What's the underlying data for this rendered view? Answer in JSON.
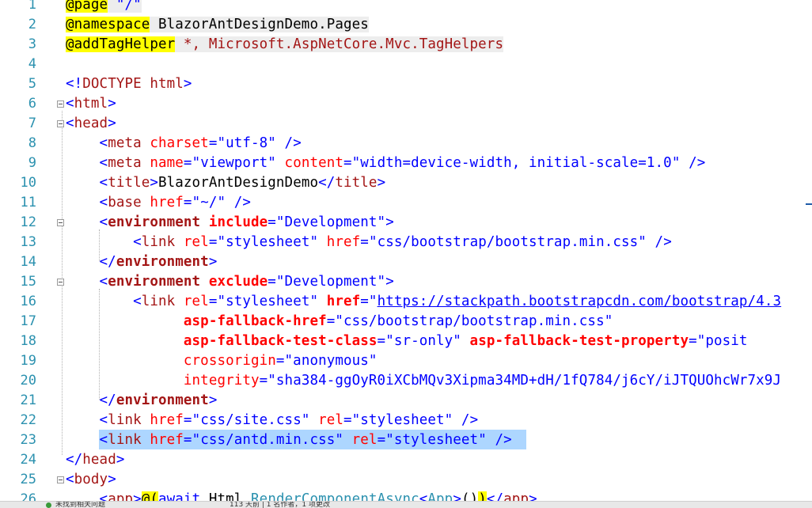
{
  "editor": {
    "line_numbers": [
      "1",
      "2",
      "3",
      "4",
      "5",
      "6",
      "7",
      "8",
      "9",
      "10",
      "11",
      "12",
      "13",
      "14",
      "15",
      "16",
      "17",
      "18",
      "19",
      "20",
      "21",
      "22",
      "23",
      "24",
      "25",
      "26"
    ],
    "lines": {
      "l1": {
        "dir": "@page",
        "rest": " \"/\""
      },
      "l2": {
        "dir": "@namespace",
        "rest": " BlazorAntDesignDemo.Pages"
      },
      "l3": {
        "dir": "@addTagHelper",
        "rest": " *, Microsoft.AspNetCore.Mvc.TagHelpers"
      },
      "l5": {
        "open": "<!",
        "tag": "DOCTYPE",
        "attr": " html",
        "close": ">"
      },
      "l6": {
        "open": "<",
        "tag": "html",
        "close": ">"
      },
      "l7": {
        "open": "<",
        "tag": "head",
        "close": ">"
      },
      "l8": {
        "indent": "    ",
        "open": "<",
        "tag": "meta",
        "a1": " charset",
        "eq1": "=",
        "v1": "\"utf-8\"",
        "close": " />"
      },
      "l9": {
        "indent": "    ",
        "open": "<",
        "tag": "meta",
        "a1": " name",
        "eq1": "=",
        "v1": "\"viewport\"",
        "a2": " content",
        "eq2": "=",
        "v2": "\"width=device-width, initial-scale=1.0\"",
        "close": " />"
      },
      "l10": {
        "indent": "    ",
        "open": "<",
        "tag": "title",
        "close": ">",
        "text": "BlazorAntDesignDemo",
        "end_open": "</",
        "end_tag": "title",
        "end_close": ">"
      },
      "l11": {
        "indent": "    ",
        "open": "<",
        "tag": "base",
        "a1": " href",
        "eq1": "=",
        "v1": "\"~/\"",
        "close": " />"
      },
      "l12": {
        "indent": "    ",
        "open": "<",
        "tag": "environment",
        "a1": " include",
        "eq1": "=",
        "v1": "\"Development\"",
        "close": ">"
      },
      "l13": {
        "indent": "        ",
        "open": "<",
        "tag": "link",
        "a1": " rel",
        "eq1": "=",
        "v1": "\"stylesheet\"",
        "a2": " href",
        "eq2": "=",
        "v2": "\"css/bootstrap/bootstrap.min.css\"",
        "close": " />"
      },
      "l14": {
        "indent": "    ",
        "open": "</",
        "tag": "environment",
        "close": ">"
      },
      "l15": {
        "indent": "    ",
        "open": "<",
        "tag": "environment",
        "a1": " exclude",
        "eq1": "=",
        "v1": "\"Development\"",
        "close": ">"
      },
      "l16": {
        "indent": "        ",
        "open": "<",
        "tag": "link",
        "a1": " rel",
        "eq1": "=",
        "v1": "\"stylesheet\"",
        "a2": " href",
        "eq2": "=\"",
        "v2": "https://stackpath.bootstrapcdn.com/bootstrap/4.3"
      },
      "l17": {
        "indent": "              ",
        "a1": "asp-fallback-href",
        "eq1": "=",
        "v1": "\"css/bootstrap/bootstrap.min.css\""
      },
      "l18": {
        "indent": "              ",
        "a1": "asp-fallback-test-class",
        "eq1": "=",
        "v1": "\"sr-only\"",
        "a2": " asp-fallback-test-property",
        "eq2": "=",
        "v2": "\"posit"
      },
      "l19": {
        "indent": "              ",
        "a1": "crossorigin",
        "eq1": "=",
        "v1": "\"anonymous\""
      },
      "l20": {
        "indent": "              ",
        "a1": "integrity",
        "eq1": "=",
        "v1": "\"sha384-ggOyR0iXCbMQv3Xipma34MD+dH/1fQ784/j6cY/iJTQUOhcWr7x9J"
      },
      "l21": {
        "indent": "    ",
        "open": "</",
        "tag": "environment",
        "close": ">"
      },
      "l22": {
        "indent": "    ",
        "open": "<",
        "tag": "link",
        "a1": " href",
        "eq1": "=",
        "v1": "\"css/site.css\"",
        "a2": " rel",
        "eq2": "=",
        "v2": "\"stylesheet\"",
        "close": " />"
      },
      "l23": {
        "indent": "    ",
        "open": "<",
        "tag": "link",
        "a1": " href",
        "eq1": "=",
        "v1": "\"css/antd.min.css\"",
        "a2": " rel",
        "eq2": "=",
        "v2": "\"stylesheet\"",
        "close": " />"
      },
      "l24": {
        "open": "</",
        "tag": "head",
        "close": ">"
      },
      "l25": {
        "open": "<",
        "tag": "body",
        "close": ">"
      },
      "l26": {
        "indent": "    ",
        "open": "<",
        "tag": "app",
        "close": ">",
        "at": "@",
        "p1": "(",
        "kw": "await",
        "sp": " Html.",
        "meth": "RenderComponentAsync",
        "lt": "<",
        "gen": "App",
        "gt": ">",
        "call": "()",
        "p2": ")",
        "end_open": "</",
        "end_tag": "app",
        "end_close": ">"
      }
    }
  },
  "status": {
    "left": "未找到相关问题",
    "right": "113 天前 | 1 名作者，1 项更改"
  },
  "colors": {
    "line_number": "#2b91af",
    "directive_bg": "#ffff00",
    "tag": "#a31515",
    "bracket": "#0000ff",
    "attribute": "#ff0000",
    "value": "#0000ff",
    "selection": "#add6ff"
  }
}
